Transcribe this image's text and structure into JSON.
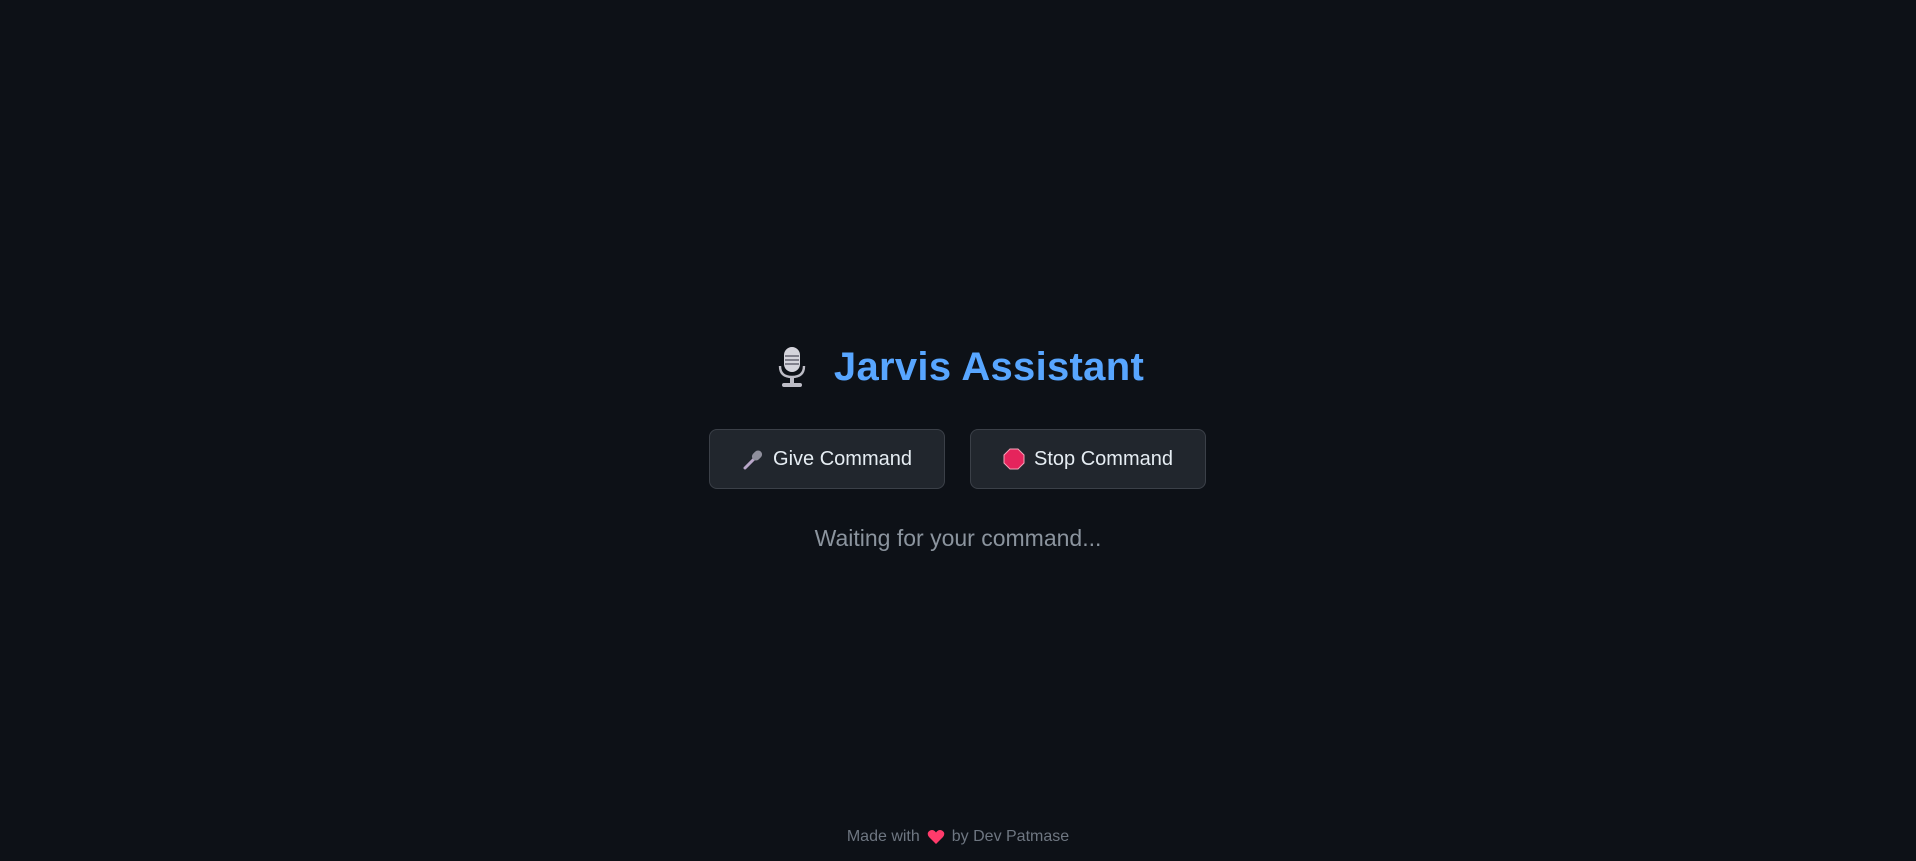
{
  "app": {
    "title": "Jarvis Assistant",
    "title_icon": "microphone-icon",
    "accent_color": "#58a6ff",
    "background_color": "#0d1117"
  },
  "buttons": {
    "give": {
      "label": "Give Command",
      "icon": "microphone-icon"
    },
    "stop": {
      "label": "Stop Command",
      "icon": "stop-icon",
      "icon_color": "#e5245c"
    }
  },
  "status": {
    "text": "Waiting for your command..."
  },
  "footer": {
    "prefix": "Made with",
    "icon": "heart-icon",
    "suffix": "by Dev Patmase"
  }
}
